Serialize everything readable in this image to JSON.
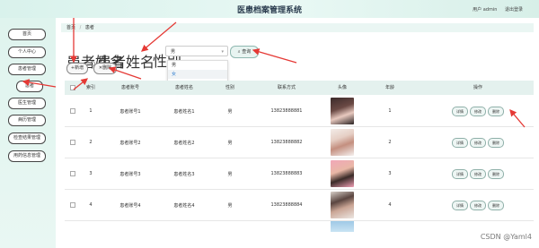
{
  "app": {
    "title": "医患档案管理系统",
    "user_label": "用户 admin",
    "logout": "退出登录"
  },
  "sidebar": {
    "items": [
      {
        "label": "首页"
      },
      {
        "label": "个人中心"
      },
      {
        "label": "患者管理"
      },
      {
        "label": "患者"
      },
      {
        "label": "医生管理"
      },
      {
        "label": "病历管理"
      },
      {
        "label": "检查结果管理"
      },
      {
        "label": "用药信息管理"
      }
    ]
  },
  "breadcrumb": {
    "home": "首页",
    "current": "患者"
  },
  "filters": {
    "radio_label": "患者姓名",
    "radio_option": "患者姓名",
    "select_label": "性别",
    "select_value": "男",
    "query_button": "查询"
  },
  "dropdown": {
    "options": [
      "男",
      "女"
    ],
    "selected": "女"
  },
  "actions": {
    "add": "新增",
    "delete": "删除"
  },
  "table": {
    "columns": [
      "索引",
      "患者账号",
      "患者姓名",
      "性别",
      "联系方式",
      "头像",
      "年龄",
      "操作"
    ],
    "rows": [
      {
        "index": "1",
        "account": "患者账号1",
        "name": "患者姓名1",
        "gender": "男",
        "phone": "13823888881",
        "age": "1"
      },
      {
        "index": "2",
        "account": "患者账号2",
        "name": "患者姓名2",
        "gender": "男",
        "phone": "13823888882",
        "age": "2"
      },
      {
        "index": "3",
        "account": "患者账号3",
        "name": "患者姓名3",
        "gender": "男",
        "phone": "13823888883",
        "age": "3"
      },
      {
        "index": "4",
        "account": "患者账号4",
        "name": "患者姓名4",
        "gender": "男",
        "phone": "13823888884",
        "age": "4"
      }
    ],
    "ops": {
      "detail": "详情",
      "edit": "修改",
      "delete": "删除"
    }
  },
  "watermark": "CSDN @Yaml4"
}
